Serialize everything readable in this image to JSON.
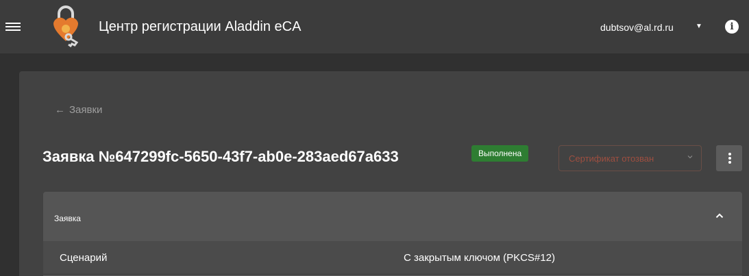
{
  "header": {
    "app_title": "Центр регистрации Aladdin eCA",
    "user_email": "dubtsov@al.rd.ru",
    "info_icon": "i"
  },
  "page": {
    "back_label": "Заявки",
    "request_title": "Заявка №647299fc-5650-43f7-ab0e-283aed67a633",
    "status_label": "Выполнена",
    "cert_status_label": "Сертификат отозван"
  },
  "panel": {
    "title": "Заявка",
    "rows": [
      {
        "label": "Сценарий",
        "value": "С закрытым ключом (PKCS#12)"
      }
    ]
  },
  "colors": {
    "topbar": "#3c3c3c",
    "background": "#303030",
    "card": "#424242",
    "status_badge": "#2e7d32",
    "cert_status_text": "#9e4f40"
  }
}
